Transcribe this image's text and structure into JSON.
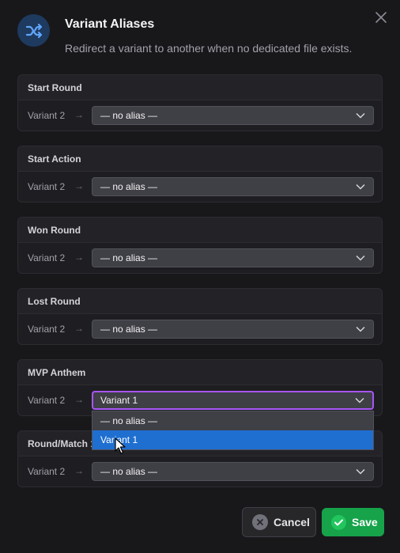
{
  "dialog": {
    "title": "Variant Aliases",
    "subtitle": "Redirect a variant to another when no dedicated file exists.",
    "icon": "shuffle-icon",
    "accent": "#a855f7"
  },
  "sections": [
    {
      "title": "Start Round",
      "variant": "Variant 2",
      "arrow": "→",
      "value": "— no alias —"
    },
    {
      "title": "Start Action",
      "variant": "Variant 2",
      "arrow": "→",
      "value": "— no alias —"
    },
    {
      "title": "Won Round",
      "variant": "Variant 2",
      "arrow": "→",
      "value": "— no alias —"
    },
    {
      "title": "Lost Round",
      "variant": "Variant 2",
      "arrow": "→",
      "value": "— no alias —"
    },
    {
      "title": "MVP Anthem",
      "variant": "Variant 2",
      "arrow": "→",
      "value": "Variant 1"
    },
    {
      "title": "Round/Match 1",
      "variant": "Variant 2",
      "arrow": "→",
      "value": "— no alias —"
    }
  ],
  "dropdown": {
    "options": [
      "— no alias —",
      "Variant 1"
    ],
    "highlighted": "Variant 1",
    "highlight_color": "#1f6fd1"
  },
  "buttons": {
    "cancel": "Cancel",
    "save": "Save",
    "save_color": "#16a34a"
  }
}
